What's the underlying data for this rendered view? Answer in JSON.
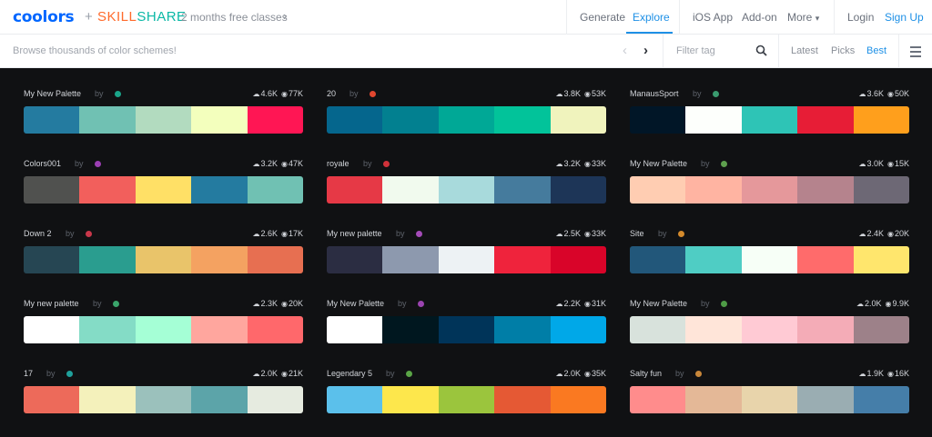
{
  "topnav": {
    "brand": "coolors",
    "plus": "+",
    "partner_a": "SKILL",
    "partner_b": "SHARE",
    "promo": "2 months free classes",
    "links": {
      "generate": "Generate",
      "explore": "Explore",
      "ios_app": "iOS App",
      "addon": "Add-on",
      "more": "More",
      "login": "Login",
      "signup": "Sign Up"
    },
    "accent_color": "#1e90e6",
    "brand_color": "#0066ff"
  },
  "subbar": {
    "browse_text": "Browse thousands of color schemes!",
    "filter_placeholder": "Filter tag",
    "sort": {
      "latest": "Latest",
      "picks": "Picks",
      "best": "Best"
    },
    "active_sort": "best"
  },
  "palettes": [
    {
      "name": "My New Palette",
      "by": "by",
      "dot": "#1aa58a",
      "saves": "4.6K",
      "views": "77K",
      "colors": [
        "#247ba0",
        "#70c1b3",
        "#b2dbbf",
        "#f3ffbd",
        "#ff1654"
      ]
    },
    {
      "name": "20",
      "by": "by",
      "dot": "#e1472f",
      "saves": "3.8K",
      "views": "53K",
      "colors": [
        "#05668d",
        "#028090",
        "#00a896",
        "#02c39a",
        "#f0f3bd"
      ]
    },
    {
      "name": "ManausSport",
      "by": "by",
      "dot": "#3a9b6f",
      "saves": "3.6K",
      "views": "50K",
      "colors": [
        "#011627",
        "#fdfffc",
        "#2ec4b6",
        "#e71d36",
        "#ff9f1c"
      ]
    },
    {
      "name": "Colors001",
      "by": "by",
      "dot": "#9b3fb3",
      "saves": "3.2K",
      "views": "47K",
      "colors": [
        "#50514f",
        "#f25f5c",
        "#ffe066",
        "#247ba0",
        "#70c1b3"
      ]
    },
    {
      "name": "royale",
      "by": "by",
      "dot": "#d1323a",
      "saves": "3.2K",
      "views": "33K",
      "colors": [
        "#e63946",
        "#f1faee",
        "#a8dadc",
        "#457b9d",
        "#1d3557"
      ]
    },
    {
      "name": "My New Palette",
      "by": "by",
      "dot": "#5ea04e",
      "saves": "3.0K",
      "views": "15K",
      "colors": [
        "#ffcdb2",
        "#ffb4a2",
        "#e5989b",
        "#b5838d",
        "#6d6875"
      ]
    },
    {
      "name": "Down 2",
      "by": "by",
      "dot": "#c8374a",
      "saves": "2.6K",
      "views": "17K",
      "colors": [
        "#264653",
        "#2a9d8f",
        "#e9c46a",
        "#f4a261",
        "#e76f51"
      ]
    },
    {
      "name": "My new palette",
      "by": "by",
      "dot": "#a44bb8",
      "saves": "2.5K",
      "views": "33K",
      "colors": [
        "#2b2d42",
        "#8d99ae",
        "#edf2f4",
        "#ef233c",
        "#d90429"
      ]
    },
    {
      "name": "Site",
      "by": "by",
      "dot": "#d48a2c",
      "saves": "2.4K",
      "views": "20K",
      "colors": [
        "#22577a",
        "#4fcdc4",
        "#f7fff7",
        "#ff6b6b",
        "#ffe66d"
      ]
    },
    {
      "name": "My new palette",
      "by": "by",
      "dot": "#3aa56b",
      "saves": "2.3K",
      "views": "20K",
      "colors": [
        "#ffffff",
        "#84dcc6",
        "#a5ffd6",
        "#ffa69e",
        "#ff686b"
      ]
    },
    {
      "name": "My New Palette",
      "by": "by",
      "dot": "#9b44b0",
      "saves": "2.2K",
      "views": "31K",
      "colors": [
        "#ffffff",
        "#00171f",
        "#003459",
        "#007ea7",
        "#00a8e8"
      ]
    },
    {
      "name": "My New Palette",
      "by": "by",
      "dot": "#4e9c46",
      "saves": "2.0K",
      "views": "9.9K",
      "colors": [
        "#d8e2dc",
        "#ffe5d9",
        "#ffcad4",
        "#f4acb7",
        "#9d8189"
      ]
    },
    {
      "name": "17",
      "by": "by",
      "dot": "#1fa09b",
      "saves": "2.0K",
      "views": "21K",
      "colors": [
        "#ed6a5a",
        "#f4f1bb",
        "#9bc1bc",
        "#5ca4a9",
        "#e6ebe0"
      ]
    },
    {
      "name": "Legendary 5",
      "by": "by",
      "dot": "#5aa546",
      "saves": "2.0K",
      "views": "35K",
      "colors": [
        "#5bc0eb",
        "#fde74c",
        "#9bc53d",
        "#e55934",
        "#fa7921"
      ]
    },
    {
      "name": "Salty fun",
      "by": "by",
      "dot": "#c8873a",
      "saves": "1.9K",
      "views": "16K",
      "colors": [
        "#ff8c8c",
        "#e4b897",
        "#e8d4ab",
        "#9aadb2",
        "#457ea9"
      ]
    }
  ],
  "icons": {
    "save": "cloud-icon",
    "views": "eye-icon",
    "search": "search-icon",
    "menu": "hamburger-icon"
  }
}
